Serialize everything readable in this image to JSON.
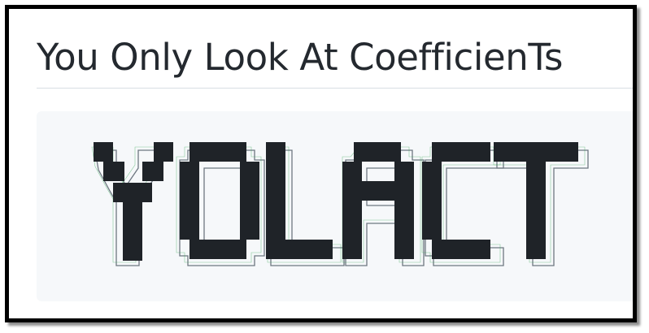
{
  "header": {
    "title": "You Only Look At CoefficienTs"
  },
  "ascii_banner": {
    "text": "YOLACT",
    "colors": {
      "block": "#1f2328",
      "outline": "#6e7781",
      "background": "#f6f8fa"
    }
  }
}
